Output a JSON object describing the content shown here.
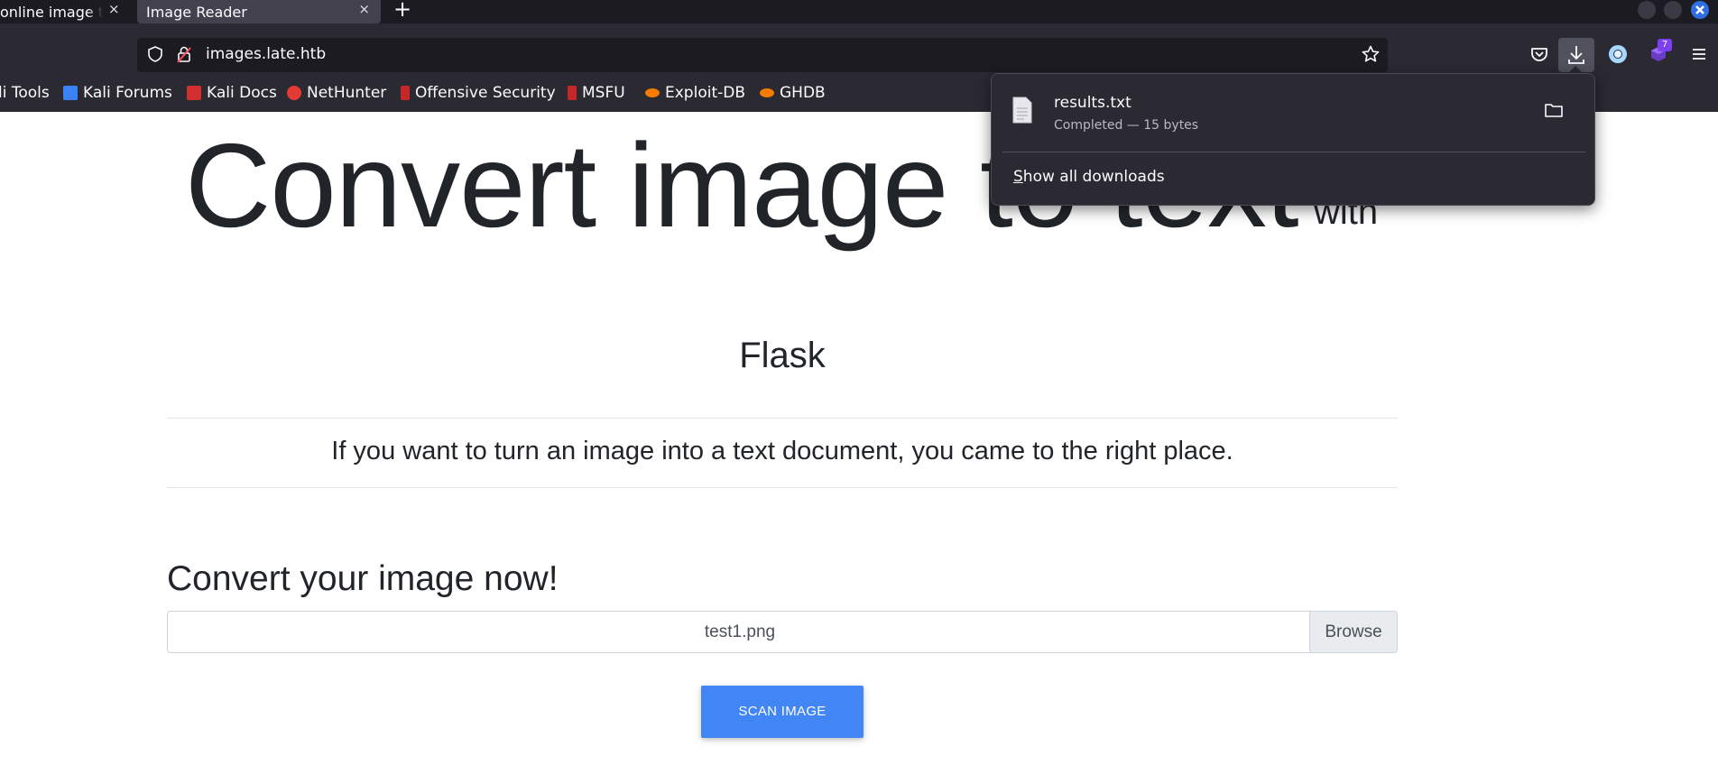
{
  "browser": {
    "tabs": [
      {
        "label": "online image to"
      },
      {
        "label": "Image Reader"
      }
    ],
    "tab_close_glyph": "×",
    "new_tab_glyph": "+",
    "url": "images.late.htb",
    "extension_badge": "7",
    "bookmarks": [
      {
        "label": "li Tools",
        "icon": "kali-icon",
        "color": "#3b6fd1"
      },
      {
        "label": "Kali Forums",
        "icon": "kali-forums-icon",
        "color": "#3b82f6"
      },
      {
        "label": "Kali Docs",
        "icon": "kali-docs-icon",
        "color": "#d32f2f"
      },
      {
        "label": "NetHunter",
        "icon": "nethunter-icon",
        "color": "#e53935"
      },
      {
        "label": "Offensive Security",
        "icon": "offsec-icon",
        "color": "#c62828"
      },
      {
        "label": "MSFU",
        "icon": "msfu-icon",
        "color": "#c62828"
      },
      {
        "label": "Exploit-DB",
        "icon": "exploitdb-icon",
        "color": "#f57c00"
      },
      {
        "label": "GHDB",
        "icon": "ghdb-icon",
        "color": "#f57c00"
      }
    ]
  },
  "downloads_panel": {
    "filename": "results.txt",
    "status": "Completed — 15 bytes",
    "show_all_accel": "S",
    "show_all_rest": "how all downloads"
  },
  "page": {
    "hero_title": "Convert image to text",
    "hero_with": "with",
    "flask_title": "Flask",
    "lead": "If you want to turn an image into a text document, you came to the right place.",
    "convert_heading": "Convert your image now!",
    "file_input_value": "test1.png",
    "browse_label": "Browse",
    "scan_button": "SCAN IMAGE"
  },
  "colors": {
    "scan_button": "#4285f4",
    "chrome_dark": "#2b2a33",
    "text_dark": "#212529"
  }
}
